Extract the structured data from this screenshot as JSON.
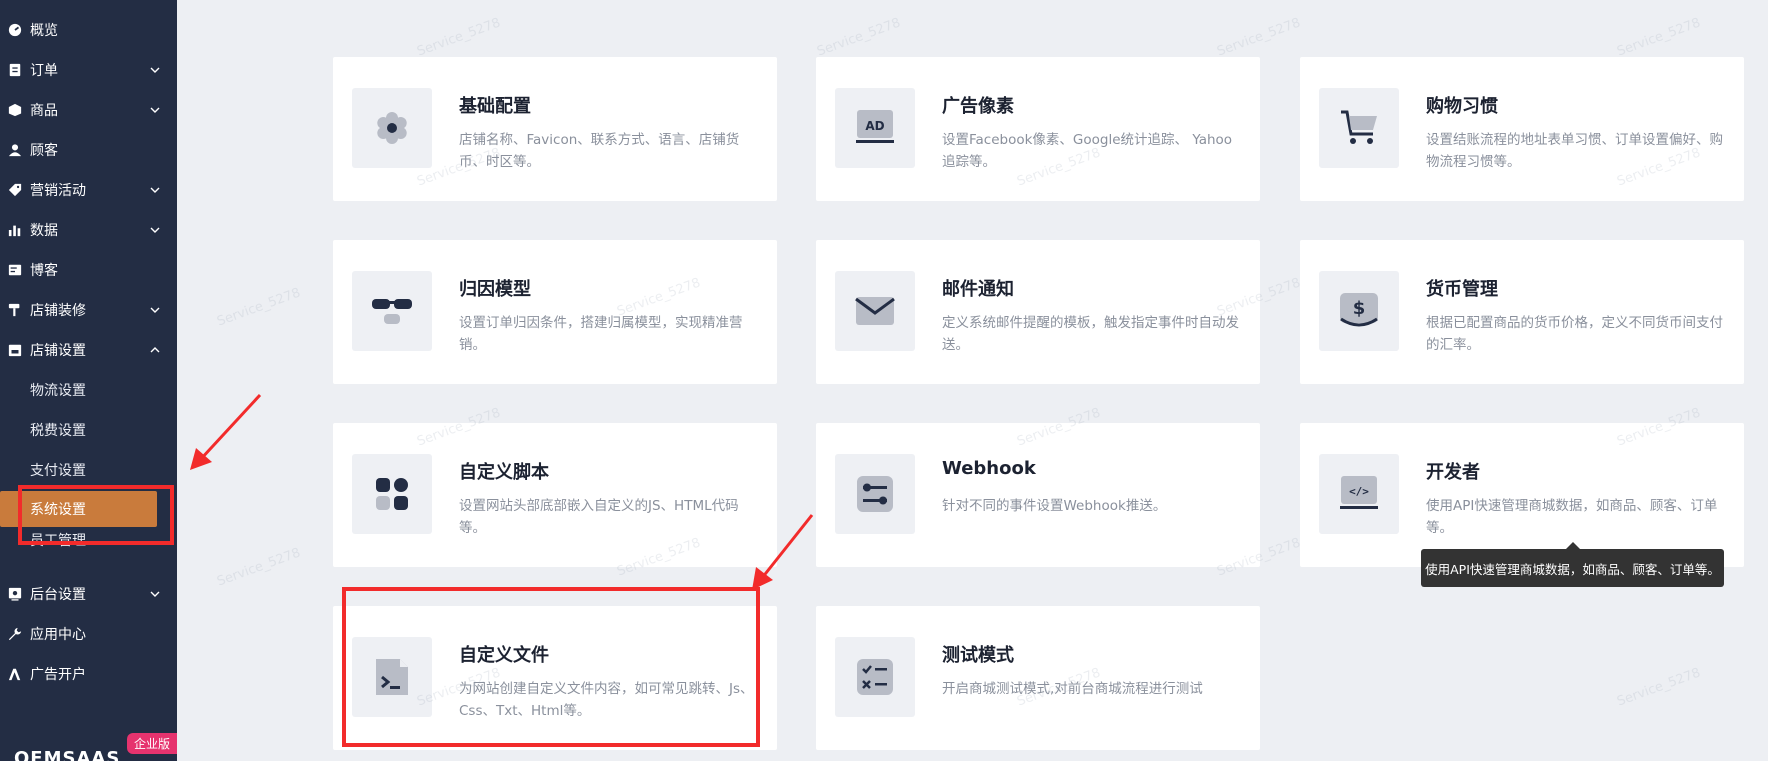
{
  "sidebar": {
    "items": [
      {
        "label": "概览",
        "icon": "dashboard-icon",
        "chevron": false
      },
      {
        "label": "订单",
        "icon": "order-icon",
        "chevron": true
      },
      {
        "label": "商品",
        "icon": "box-icon",
        "chevron": true
      },
      {
        "label": "顾客",
        "icon": "user-icon",
        "chevron": false
      },
      {
        "label": "营销活动",
        "icon": "tag-icon",
        "chevron": true
      },
      {
        "label": "数据",
        "icon": "bar-chart-icon",
        "chevron": true
      },
      {
        "label": "博客",
        "icon": "blog-icon",
        "chevron": false
      },
      {
        "label": "店铺装修",
        "icon": "paint-roller-icon",
        "chevron": true
      },
      {
        "label": "店铺设置",
        "icon": "store-icon",
        "chevron": true
      }
    ],
    "subitems": [
      "物流设置",
      "税费设置",
      "支付设置",
      "系统设置",
      "员工管理"
    ],
    "bottom_items": [
      {
        "label": "后台设置",
        "icon": "settings-panel-icon",
        "chevron": true
      },
      {
        "label": "应用中心",
        "icon": "wrench-icon",
        "chevron": false
      },
      {
        "label": "广告开户",
        "icon": "ad-account-icon",
        "chevron": false
      }
    ],
    "brand": "OEMSAAS",
    "badge": "企业版"
  },
  "cards": [
    {
      "title": "基础配置",
      "desc": "店铺名称、Favicon、联系方式、语言、店铺货币、时区等。",
      "icon": "gear-icon"
    },
    {
      "title": "广告像素",
      "desc": "设置Facebook像素、Google统计追踪、 Yahoo追踪等。",
      "icon": "ad-laptop-icon"
    },
    {
      "title": "购物习惯",
      "desc": "设置结账流程的地址表单习惯、订单设置偏好、购物流程习惯等。",
      "icon": "cart-icon"
    },
    {
      "title": "归因模型",
      "desc": "设置订单归因条件，搭建归属模型，实现精准营销。",
      "icon": "glasses-icon"
    },
    {
      "title": "邮件通知",
      "desc": "定义系统邮件提醒的模板，触发指定事件时自动发送。",
      "icon": "mail-icon"
    },
    {
      "title": "货币管理",
      "desc": "根据已配置商品的货币价格，定义不同货币间支付的汇率。",
      "icon": "currency-icon"
    },
    {
      "title": "自定义脚本",
      "desc": "设置网站头部底部嵌入自定义的JS、HTML代码等。",
      "icon": "blocks-icon"
    },
    {
      "title": "Webhook",
      "desc": "针对不同的事件设置Webhook推送。",
      "icon": "webhook-icon"
    },
    {
      "title": "开发者",
      "desc": "使用API快速管理商城数据，如商品、顾客、订单等。",
      "icon": "code-laptop-icon"
    },
    {
      "title": "自定义文件",
      "desc": "为网站创建自定义文件内容，如可常见跳转、Js、Css、Txt、Html等。",
      "icon": "terminal-file-icon"
    },
    {
      "title": "测试模式",
      "desc": "开启商城测试模式,对前台商城流程进行测试",
      "icon": "checklist-icon"
    }
  ],
  "tooltip": "使用API快速管理商城数据，如商品、顾客、订单等。",
  "watermark": "Service_5278",
  "colors": {
    "sidebar": "#232d44",
    "active": "#c97b3c",
    "annotation": "#f22b2b",
    "icon": "#232d44"
  }
}
